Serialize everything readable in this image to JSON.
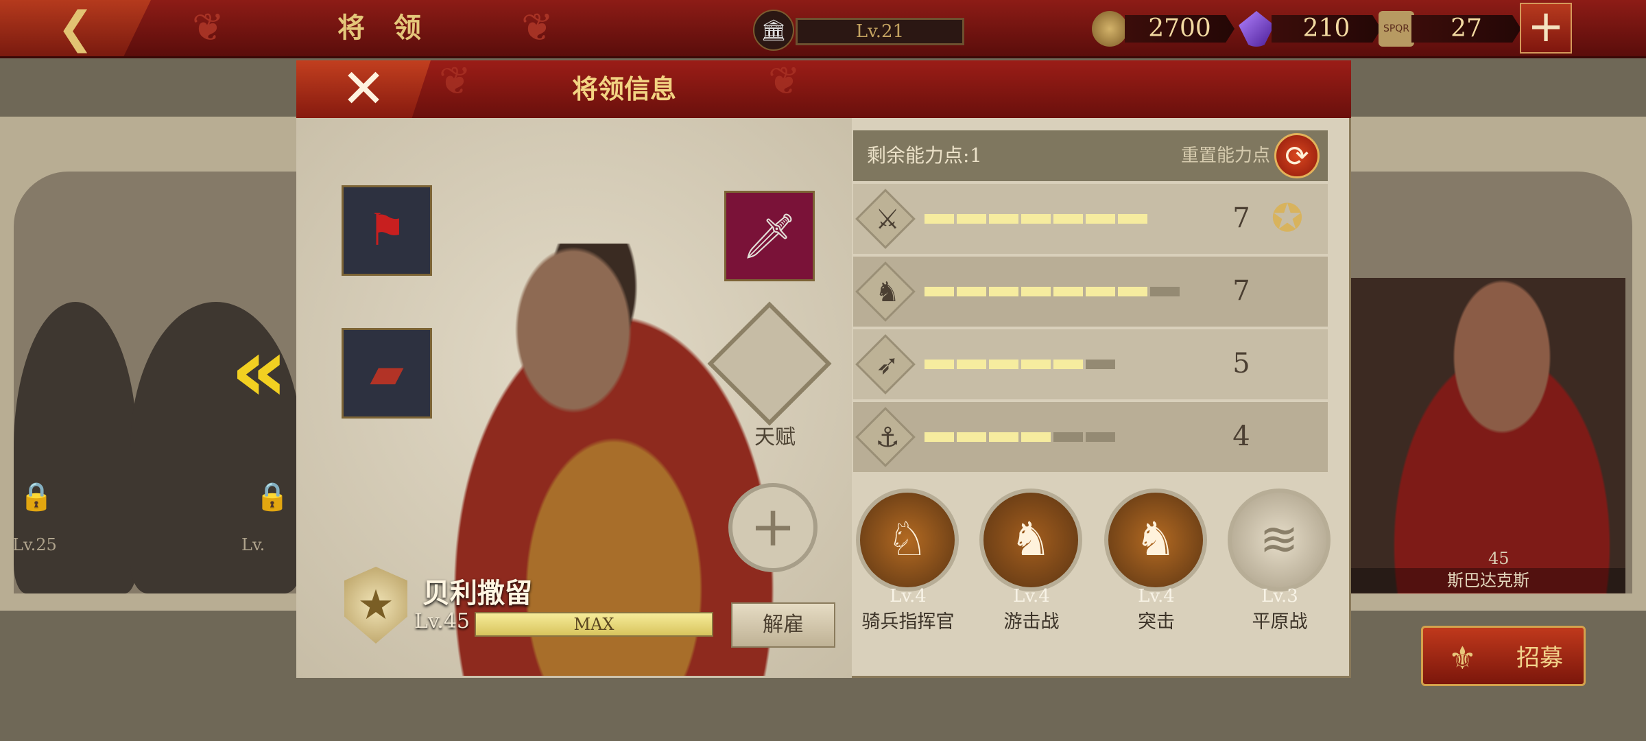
{
  "topbar": {
    "back_icon": "chevron-left-icon",
    "title": "将 领",
    "level": "Lv.21",
    "gold": "2700",
    "gems": "210",
    "tokens": "27",
    "tokens_badge": "SPQR",
    "add_icon": "plus-icon"
  },
  "background": {
    "left_generals": [
      {
        "level": "Lv.25"
      },
      {
        "level": "Lv."
      }
    ],
    "right_general": {
      "name": "斯巴达克斯",
      "level": "45"
    },
    "recruit_label": "招募"
  },
  "modal": {
    "title": "将领信息",
    "talent_label": "天赋",
    "hero": {
      "name": "贝利撒留",
      "level": "Lv.45",
      "exp_text": "MAX",
      "exp_fraction": 1.0
    },
    "dismiss_label": "解雇",
    "points": {
      "label": "剩余能力点:",
      "value": "1",
      "reset_label": "重置能力点"
    },
    "stats": [
      {
        "icon": "sword-icon",
        "value": "7",
        "filled": 7,
        "total": 7
      },
      {
        "icon": "horse-icon",
        "value": "7",
        "filled": 7,
        "total": 8
      },
      {
        "icon": "bow-icon",
        "value": "5",
        "filled": 5,
        "total": 6
      },
      {
        "icon": "anchor-icon",
        "value": "4",
        "filled": 4,
        "total": 6
      }
    ],
    "skills": [
      {
        "level": "Lv.4",
        "name": "骑兵指挥官",
        "color": "#b36a22"
      },
      {
        "level": "Lv.4",
        "name": "游击战",
        "color": "#a35e1e"
      },
      {
        "level": "Lv.4",
        "name": "突击",
        "color": "#b36a22"
      },
      {
        "level": "Lv.3",
        "name": "平原战",
        "color": "#c3b89f"
      }
    ]
  },
  "colors": {
    "accent_red": "#8d1c16",
    "gold_text": "#e4c77a",
    "bar_on": "#f6ec9f"
  }
}
